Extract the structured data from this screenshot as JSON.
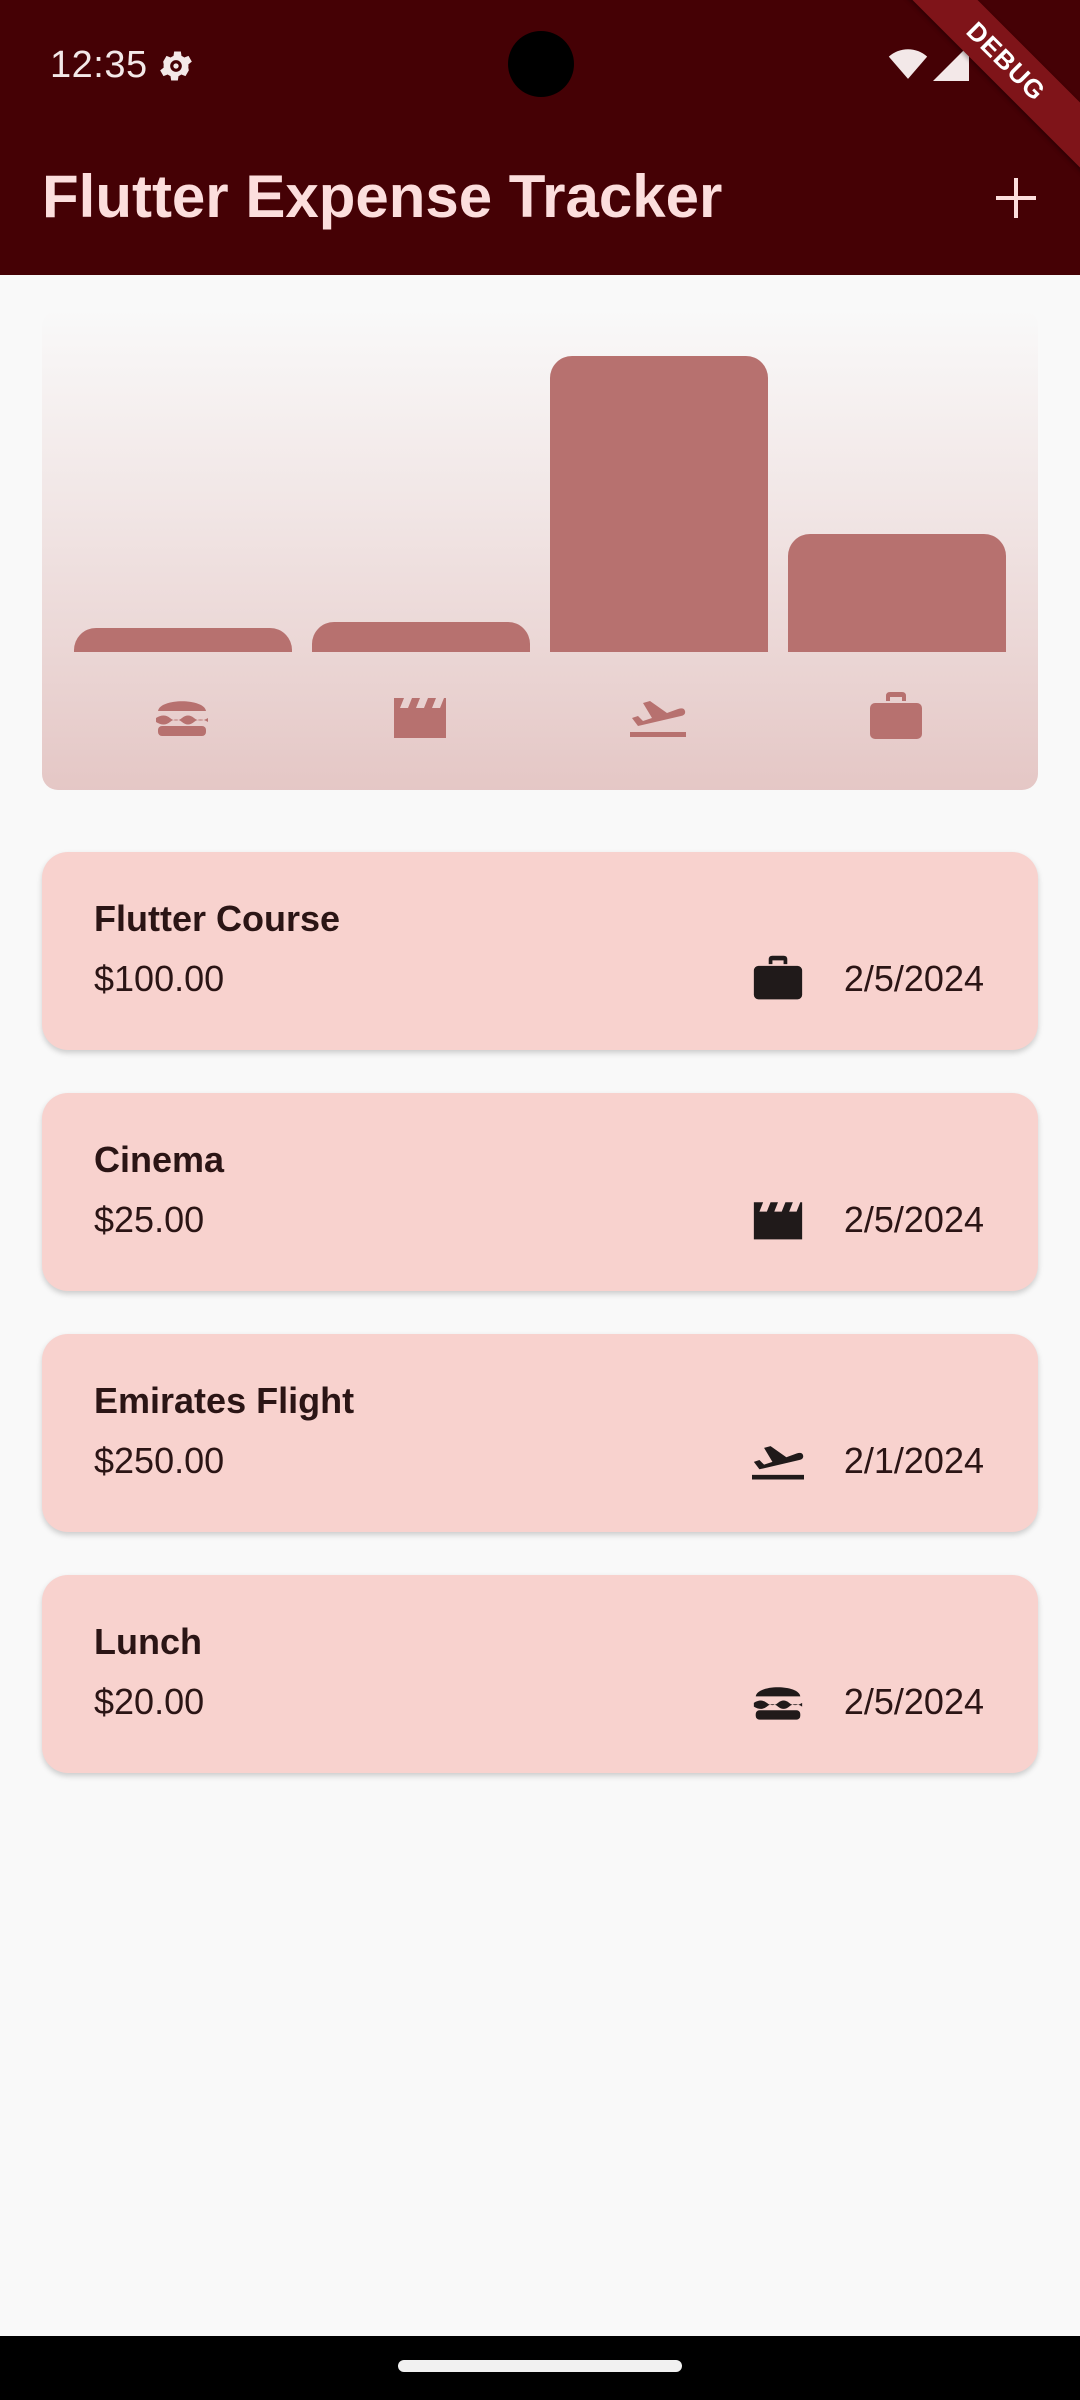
{
  "status_bar": {
    "time": "12:35"
  },
  "debug_banner": "DEBUG",
  "app_bar": {
    "title": "Flutter Expense Tracker",
    "add_icon": "plus-icon"
  },
  "colors": {
    "app_bar": "#450105",
    "title_text": "#fcdedd",
    "bar": "#b7716f",
    "chart_icon": "#b7716f",
    "card": "#f8d2ce",
    "background": "#f9f9f9"
  },
  "chart": {
    "categories": [
      "food",
      "leisure",
      "travel",
      "work"
    ],
    "icons": [
      "food-icon",
      "movie-icon",
      "flight-icon",
      "work-icon"
    ],
    "bar_fill_fraction": [
      0.08,
      0.1,
      1.0,
      0.4
    ]
  },
  "expenses": [
    {
      "title": "Flutter Course",
      "amount": "$100.00",
      "icon": "work-icon",
      "date": "2/5/2024"
    },
    {
      "title": "Cinema",
      "amount": "$25.00",
      "icon": "movie-icon",
      "date": "2/5/2024"
    },
    {
      "title": "Emirates Flight",
      "amount": "$250.00",
      "icon": "flight-icon",
      "date": "2/1/2024"
    },
    {
      "title": "Lunch",
      "amount": "$20.00",
      "icon": "food-icon",
      "date": "2/5/2024"
    }
  ]
}
